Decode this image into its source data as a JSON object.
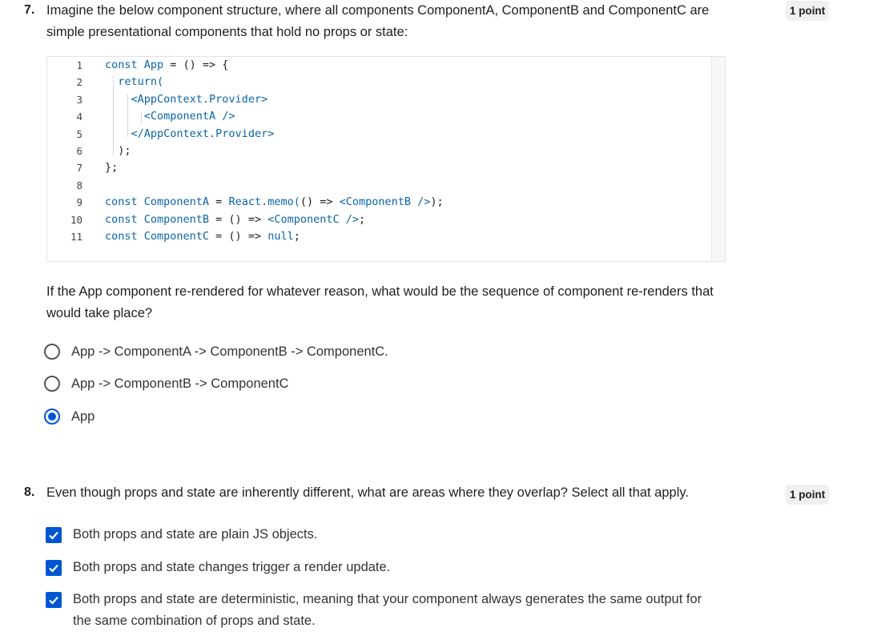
{
  "q7": {
    "number": "7.",
    "prompt": "Imagine the below component structure, where all components ComponentA, ComponentB and ComponentC are simple presentational components that hold no props or state:",
    "points": "1 point",
    "code_line_numbers": [
      "1",
      "2",
      "3",
      "4",
      "5",
      "6",
      "7",
      "8",
      "9",
      "10",
      "11"
    ],
    "code": {
      "l1_kw": "const App",
      "l1_rest": " = () => {",
      "l2": "return(",
      "l3": "<AppContext.Provider>",
      "l4": "<ComponentA />",
      "l5": "</AppContext.Provider>",
      "l6": ");",
      "l7": "};",
      "l9_kw": "const ComponentA",
      "l9_rest": " = ",
      "l9_fn": "React.memo(",
      "l9_mid": "() => ",
      "l9_tag": "<ComponentB />",
      "l9_end": ");",
      "l10_kw": "const ComponentB",
      "l10_rest": " = () => ",
      "l10_tag": "<ComponentC />",
      "l10_end": ";",
      "l11_kw": "const ComponentC",
      "l11_rest": " = () => ",
      "l11_null": "null",
      "l11_end": ";"
    },
    "question": "If the App component re-rendered for whatever reason, what would be the sequence of component re-renders that would take place?",
    "options": [
      {
        "label": "App -> ComponentA -> ComponentB -> ComponentC.",
        "selected": false
      },
      {
        "label": "App -> ComponentB -> ComponentC",
        "selected": false
      },
      {
        "label": "App",
        "selected": true
      }
    ]
  },
  "q8": {
    "number": "8.",
    "prompt": "Even though props and state are inherently different, what are areas where they overlap? Select all that apply.",
    "points": "1 point",
    "options": [
      {
        "label": "Both props and state are plain JS objects.",
        "checked": true
      },
      {
        "label": "Both props and state changes trigger a render update.",
        "checked": true
      },
      {
        "label": "Both props and state are deterministic, meaning that your component always generates the same output for the same combination of props and state.",
        "checked": true
      }
    ]
  },
  "colors": {
    "accent": "#0056d2",
    "code_keyword": "#0b64a6"
  }
}
